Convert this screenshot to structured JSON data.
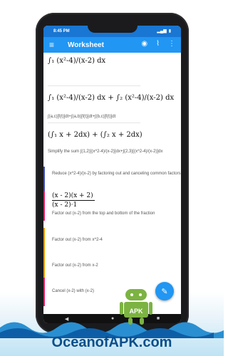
{
  "status": {
    "time": "8:45 PM",
    "battery": "▮"
  },
  "appbar": {
    "title": "Worksheet",
    "menu_icon": "hamburger-icon",
    "camera_icon": "camera-icon",
    "chart_icon": "chart-icon",
    "more_icon": "more-vertical-icon"
  },
  "content": {
    "expr1": "∫₁ (x²-4)/(x-2) dx",
    "expr2": "∫₁ (x²-4)/(x-2) dx + ∫₂ (x²-4)/(x-2) dx",
    "expr2_note": "∫(a,c)[f(t)]dt+∫(a,b)[f(t)]dt+∫(b,c)[f(t)]dt",
    "expr3": "(∫₁ x + 2dx) + (∫₂ x + 2dx)",
    "expr3_note": "Simplify the sum ∫(1,2)[(x^2-4)/(x-2)]dx+∫(2,3)[(x^2-4)/(x-2)]dx",
    "step_reduce": "Reduce (x^2-4)/(x-2) by factoring out and canceling common factors",
    "fraction_num": "(x - 2)(x + 2)",
    "fraction_den": "(x - 2)·1",
    "factor_top_bottom": "Factor out (x-2) from the top and bottom of the fraction",
    "factor_x2": "Factor out (x-2) from x^2-4",
    "factor_x": "Factor out (x-2) from x-2",
    "cancel": "Cancel (x-2) with (x-2)"
  },
  "fab": {
    "icon": "pencil-icon"
  },
  "nav": {
    "back": "◀",
    "home": "●",
    "recent": "■"
  },
  "watermark": {
    "brand": "OceanofAPK.com",
    "badge": "APK"
  },
  "colors": {
    "primary": "#2196f3",
    "primary_dark": "#1976d2",
    "accent_blue": "#3f51b5",
    "accent_pink": "#e91e63",
    "accent_orange": "#ff9800"
  }
}
